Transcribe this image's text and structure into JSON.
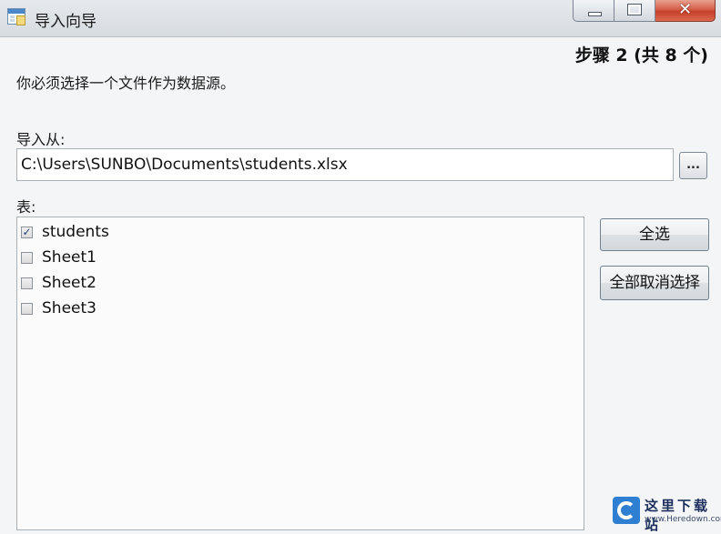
{
  "window": {
    "title": "导入向导",
    "close_glyph": "✕"
  },
  "step_text": "步骤 2 (共 8 个)",
  "instruction": "你必须选择一个文件作为数据源。",
  "import_from": {
    "label": "导入从:",
    "value": "C:\\Users\\SUNBO\\Documents\\students.xlsx",
    "browse_label": "..."
  },
  "table": {
    "label": "表:",
    "items": [
      {
        "label": "students",
        "checked": true,
        "mark": "✓"
      },
      {
        "label": "Sheet1",
        "checked": false,
        "mark": ""
      },
      {
        "label": "Sheet2",
        "checked": false,
        "mark": ""
      },
      {
        "label": "Sheet3",
        "checked": false,
        "mark": ""
      }
    ]
  },
  "buttons": {
    "select_all": "全选",
    "deselect_all": "全部取消选择"
  },
  "watermark": {
    "name": "这里下载站",
    "url": "www.Heredown.com"
  },
  "icons": {
    "app": "import-wizard-icon",
    "minimize": "minimize-icon",
    "maximize": "maximize-icon",
    "close": "close-icon",
    "checkbox": "checkbox-icon",
    "watermark_logo": "heredown-logo-icon"
  },
  "colors": {
    "close_button": "#c7402a",
    "title_bar": "#dfe3e7",
    "window_bg": "#f4f5f6",
    "watermark_logo": "#2e7fd1"
  }
}
